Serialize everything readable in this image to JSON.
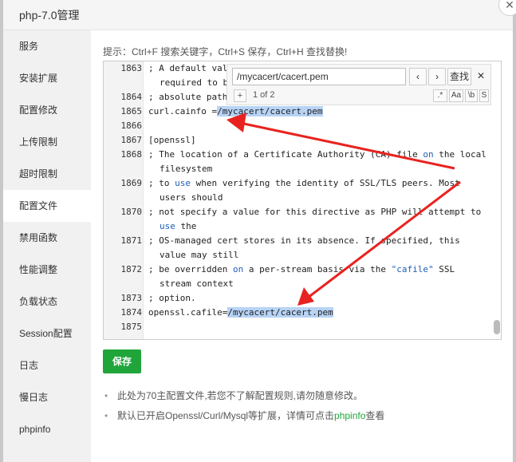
{
  "window": {
    "title": "php-7.0管理",
    "close_glyph": "✕"
  },
  "sidebar": {
    "items": [
      {
        "label": "服务"
      },
      {
        "label": "安装扩展"
      },
      {
        "label": "配置修改"
      },
      {
        "label": "上传限制"
      },
      {
        "label": "超时限制"
      },
      {
        "label": "配置文件"
      },
      {
        "label": "禁用函数"
      },
      {
        "label": "性能调整"
      },
      {
        "label": "负载状态"
      },
      {
        "label": "Session配置"
      },
      {
        "label": "日志"
      },
      {
        "label": "慢日志"
      },
      {
        "label": "phpinfo"
      }
    ],
    "active_label": "配置文件"
  },
  "hint": "提示：Ctrl+F 搜索关键字，Ctrl+S 保存，Ctrl+H 查找替换!",
  "search": {
    "query": "/mycacert/cacert.pem",
    "prev_glyph": "‹",
    "next_glyph": "›",
    "find_label": "查找",
    "close_glyph": "✕",
    "add_glyph": "+",
    "match_count": "1 of 2",
    "opt_regex": ".*",
    "opt_case": "Aa",
    "opt_word": "\\b",
    "opt_selection": "S"
  },
  "editor": {
    "current_line": "1865",
    "lines": [
      {
        "num": "1863",
        "text": "; A default val",
        "cont": "required to b"
      },
      {
        "num": "1864",
        "text": "; absolute path"
      },
      {
        "num": "1865",
        "pre": "curl.cainfo =",
        "match": "/mycacert/cacert.pem"
      },
      {
        "num": "1866",
        "text": ""
      },
      {
        "num": "1867",
        "text": "[openssl]"
      },
      {
        "num": "1868",
        "pre": "; The location of a Certificate Authority (CA) file ",
        "kw": "on",
        "post": " the local",
        "cont": "filesystem"
      },
      {
        "num": "1869",
        "pre": "; to ",
        "kw": "use",
        "post": " when verifying the identity of SSL/TLS peers. Most",
        "cont": "users should"
      },
      {
        "num": "1870",
        "text": "; not specify a value for this directive as PHP will attempt to",
        "cont_kw": "use",
        "cont_post": " the"
      },
      {
        "num": "1871",
        "text": "; OS-managed cert stores in its absence. If specified, this",
        "cont": "value may still"
      },
      {
        "num": "1872",
        "pre": "; be overridden ",
        "kw": "on",
        "post": " a per-stream basis via the ",
        "str": "\"cafile\"",
        "post2": " SSL",
        "cont": "stream context"
      },
      {
        "num": "1873",
        "text": "; option."
      },
      {
        "num": "1874",
        "pre": "openssl.cafile=",
        "match": "/mycacert/cacert.pem"
      },
      {
        "num": "1875",
        "text": ""
      }
    ]
  },
  "save_label": "保存",
  "notes": {
    "note1": "此处为70主配置文件,若您不了解配置规则,请勿随意修改。",
    "note2_pre": "默认已开启Openssl/Curl/Mysql等扩展，详情可点击",
    "note2_link": "phpinfo",
    "note2_post": "查看"
  },
  "colors": {
    "accent": "#20a53a",
    "annotation_arrow": "#e8231f",
    "match_highlight": "#b7d3f5"
  }
}
